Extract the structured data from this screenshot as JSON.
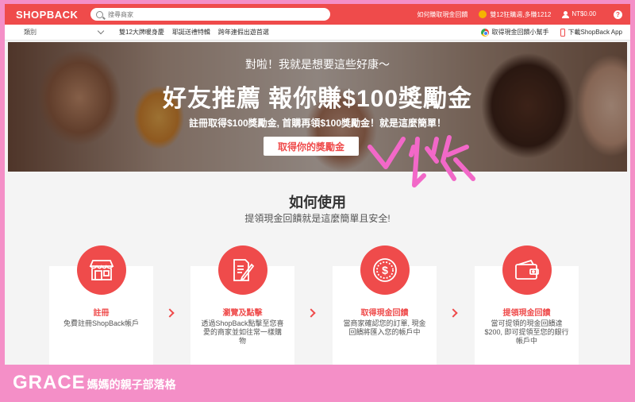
{
  "topbar": {
    "logo": "SHOPBACK",
    "search_placeholder": "搜尋商家",
    "how_to_earn": "如何賺取現金回饋",
    "promo": "雙12狂購週,多賺1212",
    "balance": "NT$0.00",
    "help": "?"
  },
  "navbar": {
    "category": "類別",
    "links": [
      "雙12大牌暖身慶",
      "耶誕送禮特輯",
      "跨年連假出遊首選"
    ],
    "extension": "取得現金回饋小幫手",
    "app": "下載ShopBack App"
  },
  "hero": {
    "subtitle": "對啦！我就是想要這些好康～",
    "title": "好友推薦  報你賺$100獎勵金",
    "desc": "註冊取得$100獎勵金, 首購再領$100獎勵金！就是這麼簡單！",
    "button": "取得你的獎勵金"
  },
  "how": {
    "title": "如何使用",
    "subtitle": "提領現金回饋就是這麼簡單且安全!",
    "steps": [
      {
        "title": "註冊",
        "desc": "免費註冊ShopBack帳戶",
        "icon": "store-icon"
      },
      {
        "title": "瀏覽及點擊",
        "desc": "透過ShopBack點擊至您喜愛的商家並如往常一樣購物",
        "icon": "document-pen-icon"
      },
      {
        "title": "取得現金回饋",
        "desc": "當商家確認您的訂單, 現金回饋將匯入您的帳戶中",
        "icon": "dollar-coin-icon"
      },
      {
        "title": "提領現金回饋",
        "desc": "當可提領的現金回饋達$200, 即可提領至您的銀行帳戶中",
        "icon": "wallet-icon"
      }
    ]
  },
  "watermark": {
    "brand": "GRACE",
    "text": "媽媽的親子部落格"
  },
  "colors": {
    "accent": "#ef4b4b",
    "frame": "#f48fc7"
  }
}
